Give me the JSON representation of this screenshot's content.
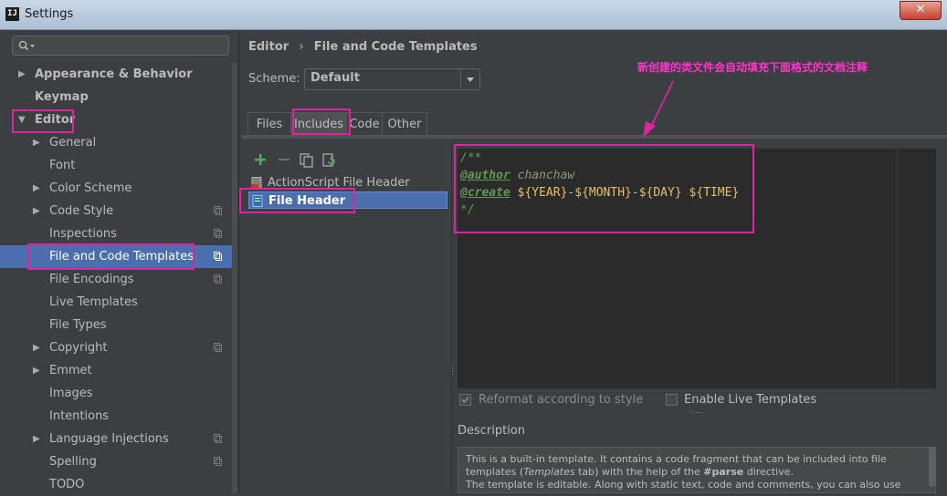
{
  "window": {
    "title": "Settings",
    "app_icon": "IJ",
    "close_label": "✕"
  },
  "sidebar": {
    "search_placeholder": "",
    "items": [
      {
        "label": "Appearance & Behavior",
        "level": 0,
        "bold": true,
        "arrow": "▶"
      },
      {
        "label": "Keymap",
        "level": 0,
        "bold": true,
        "arrow": ""
      },
      {
        "label": "Editor",
        "level": 0,
        "bold": true,
        "arrow": "▼"
      },
      {
        "label": "General",
        "level": 1,
        "arrow": "▶"
      },
      {
        "label": "Font",
        "level": 1,
        "arrow": ""
      },
      {
        "label": "Color Scheme",
        "level": 1,
        "arrow": "▶"
      },
      {
        "label": "Code Style",
        "level": 1,
        "arrow": "▶",
        "copy": true
      },
      {
        "label": "Inspections",
        "level": 1,
        "arrow": "",
        "copy": true
      },
      {
        "label": "File and Code Templates",
        "level": 1,
        "arrow": "",
        "copy": true,
        "selected": true
      },
      {
        "label": "File Encodings",
        "level": 1,
        "arrow": "",
        "copy": true
      },
      {
        "label": "Live Templates",
        "level": 1,
        "arrow": ""
      },
      {
        "label": "File Types",
        "level": 1,
        "arrow": ""
      },
      {
        "label": "Copyright",
        "level": 1,
        "arrow": "▶",
        "copy": true
      },
      {
        "label": "Emmet",
        "level": 1,
        "arrow": "▶"
      },
      {
        "label": "Images",
        "level": 1,
        "arrow": ""
      },
      {
        "label": "Intentions",
        "level": 1,
        "arrow": ""
      },
      {
        "label": "Language Injections",
        "level": 1,
        "arrow": "▶",
        "copy": true
      },
      {
        "label": "Spelling",
        "level": 1,
        "arrow": "",
        "copy": true
      },
      {
        "label": "TODO",
        "level": 1,
        "arrow": ""
      }
    ]
  },
  "breadcrumb": {
    "part1": "Editor",
    "sep": "›",
    "part2": "File and Code Templates"
  },
  "scheme": {
    "label": "Scheme:",
    "value": "Default"
  },
  "tabs": [
    {
      "label": "Files",
      "active": false
    },
    {
      "label": "Includes",
      "active": true
    },
    {
      "label": "Code",
      "active": false
    },
    {
      "label": "Other",
      "active": false
    }
  ],
  "templates": [
    {
      "label": "ActionScript File Header",
      "selected": false
    },
    {
      "label": "File Header",
      "selected": true
    }
  ],
  "editor": {
    "line1": "/**",
    "line2_tag": "@author",
    "line2_val": " chanchaw",
    "line3_tag": "@create",
    "line3_var1": " ${YEAR}",
    "line3_sep1": "-",
    "line3_var2": "${MONTH}",
    "line3_sep2": "-",
    "line3_var3": "${DAY}",
    "line3_var4": " ${TIME}",
    "line4": "*/"
  },
  "options": {
    "reformat_label": "Reformat according to style",
    "reformat_checked": true,
    "live_templates_label": "Enable Live Templates",
    "live_templates_checked": false
  },
  "description": {
    "title": "Description",
    "line1": "This is a built-in template. It contains a code fragment that can be included into file",
    "line2_a": "templates (",
    "line2_em": "Templates",
    "line2_b": " tab) with the help of the ",
    "line2_strong": "#parse",
    "line2_c": " directive.",
    "line3": "The template is editable. Along with static text, code and comments, you can also use"
  },
  "annotation": {
    "text": "新创建的类文件会自动填充下面格式的文档注释",
    "color": "#e0249e"
  }
}
